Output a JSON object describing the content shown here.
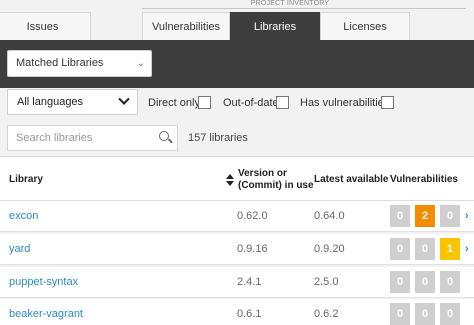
{
  "header": {
    "project_label": "PROJECT INVENTORY"
  },
  "tabs": [
    {
      "label": "Issues",
      "active": false
    },
    {
      "label": "Vulnerabilities",
      "active": false
    },
    {
      "label": "Libraries",
      "active": true
    },
    {
      "label": "Licenses",
      "active": false
    }
  ],
  "library_select": {
    "value": "Matched Libraries"
  },
  "filters": {
    "language": "All languages",
    "direct_only": {
      "label": "Direct only",
      "checked": false
    },
    "out_of_date": {
      "label": "Out-of-date",
      "checked": false
    },
    "has_vulnerabilities": {
      "label": "Has vulnerabilities",
      "checked": false
    }
  },
  "search": {
    "placeholder": "Search libraries",
    "count_text": "157 libraries"
  },
  "table": {
    "columns": {
      "library": "Library",
      "version_l1": "Version or",
      "version_l2": "(Commit) in use",
      "latest": "Latest available",
      "vulns": "Vulnerabilities"
    },
    "rows": [
      {
        "name": "excon",
        "version": "0.62.0",
        "latest": "0.64.0",
        "v": [
          "0",
          "2",
          "0"
        ]
      },
      {
        "name": "yard",
        "version": "0.9.16",
        "latest": "0.9.20",
        "v": [
          "0",
          "0",
          "1"
        ]
      },
      {
        "name": "puppet-syntax",
        "version": "2.4.1",
        "latest": "2.5.0",
        "v": [
          "0",
          "0",
          "0"
        ]
      },
      {
        "name": "beaker-vagrant",
        "version": "0.6.1",
        "latest": "0.6.2",
        "v": [
          "0",
          "0",
          "0"
        ]
      }
    ]
  },
  "colors": {
    "dark_band": "#3d3d3d",
    "link": "#2a8bc9",
    "medium": "#f28c00",
    "low": "#f9c400",
    "none": "#cfcfcf"
  }
}
